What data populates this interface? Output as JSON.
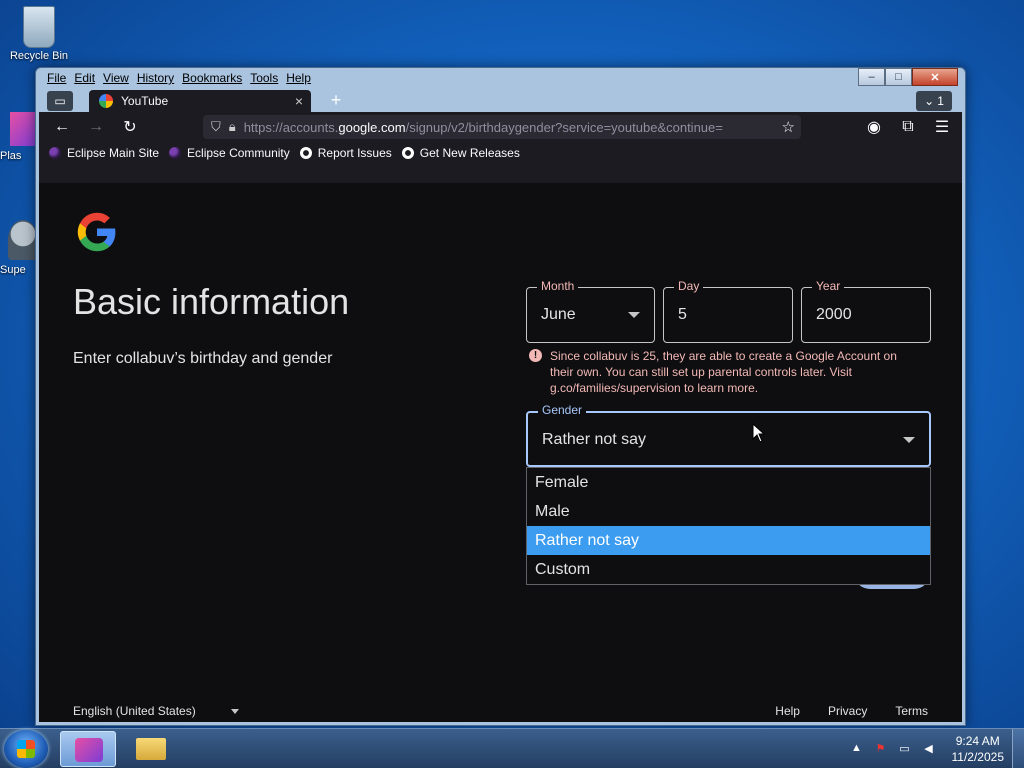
{
  "desktop": {
    "icons": [
      {
        "label": "Recycle Bin"
      },
      {
        "label": "Plas"
      },
      {
        "label": "Supe"
      }
    ]
  },
  "window": {
    "menu": [
      "File",
      "Edit",
      "View",
      "History",
      "Bookmarks",
      "Tools",
      "Help"
    ],
    "controls": {
      "minimize": "–",
      "maximize": "□",
      "close": "✕"
    }
  },
  "browser": {
    "tab": {
      "title": "YouTube",
      "close": "×"
    },
    "new_tab": "+",
    "tab_count": "1",
    "url": {
      "prefix": "https://accounts.",
      "domain": "google.com",
      "path": "/signup/v2/birthdaygender?service=youtube&continue="
    },
    "bookmarks": [
      "Eclipse Main Site",
      "Eclipse Community",
      "Report Issues",
      "Get New Releases"
    ]
  },
  "page": {
    "title": "Basic information",
    "subtitle": "Enter collabuv’s birthday and gender",
    "month": {
      "label": "Month",
      "value": "June"
    },
    "day": {
      "label": "Day",
      "value": "5"
    },
    "year": {
      "label": "Year",
      "value": "2000"
    },
    "error": "Since collabuv is 25, they are able to create a Google Account on their own. You can still set up parental controls later. Visit g.co/families/supervision to learn more.",
    "gender": {
      "label": "Gender",
      "value": "Rather not say"
    },
    "gender_options": [
      "Female",
      "Male",
      "Rather not say",
      "Custom"
    ],
    "selected_option": "Rather not say",
    "footer": {
      "language": "English (United States)",
      "links": [
        "Help",
        "Privacy",
        "Terms"
      ]
    }
  },
  "taskbar": {
    "time": "9:24 AM",
    "date": "11/2/2025"
  },
  "colors": {
    "accent": "#a8c7fa",
    "error": "#f2b8b5",
    "selected_bg": "#3b9cf0"
  }
}
